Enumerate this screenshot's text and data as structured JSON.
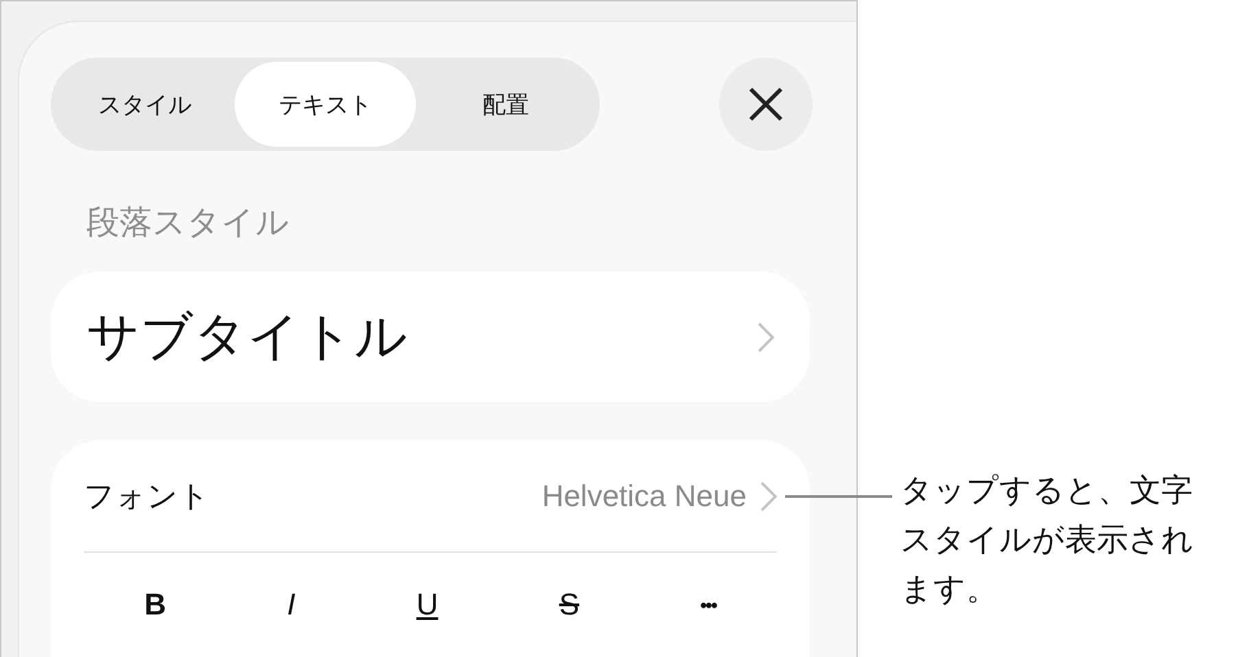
{
  "tabs": [
    {
      "label": "スタイル",
      "selected": false
    },
    {
      "label": "テキスト",
      "selected": true
    },
    {
      "label": "配置",
      "selected": false
    }
  ],
  "section_label": "段落スタイル",
  "paragraph_style": {
    "value": "サブタイトル"
  },
  "font": {
    "label": "フォント",
    "value": "Helvetica Neue"
  },
  "format_buttons": [
    {
      "kind": "bold",
      "label": "B"
    },
    {
      "kind": "italic",
      "label": "I"
    },
    {
      "kind": "underline",
      "label": "U"
    },
    {
      "kind": "strike",
      "label": "S"
    },
    {
      "kind": "more",
      "label": "•••"
    }
  ],
  "callout": {
    "text": "タップすると、文字スタイルが表示されます。"
  }
}
